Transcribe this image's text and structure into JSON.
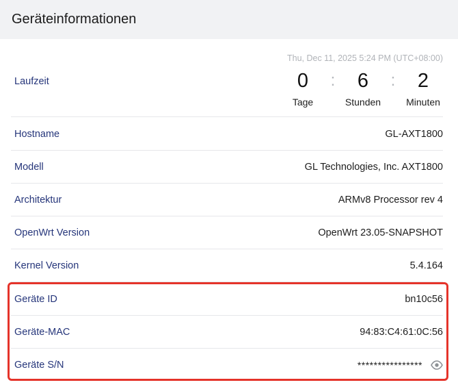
{
  "header": {
    "title": "Geräteinformationen"
  },
  "timestamp": "Thu, Dec 11, 2025 5:24 PM (UTC+08:00)",
  "uptime": {
    "label": "Laufzeit",
    "days": "0",
    "days_label": "Tage",
    "hours": "6",
    "hours_label": "Stunden",
    "minutes": "2",
    "minutes_label": "Minuten",
    "separator": ":"
  },
  "info": {
    "hostname": {
      "label": "Hostname",
      "value": "GL-AXT1800"
    },
    "model": {
      "label": "Modell",
      "value": "GL Technologies, Inc. AXT1800"
    },
    "architecture": {
      "label": "Architektur",
      "value": "ARMv8 Processor rev 4"
    },
    "openwrt": {
      "label": "OpenWrt Version",
      "value": "OpenWrt 23.05-SNAPSHOT"
    },
    "kernel": {
      "label": "Kernel Version",
      "value": "5.4.164"
    },
    "device_id": {
      "label": "Geräte ID",
      "value": "bn10c56"
    },
    "device_mac": {
      "label": "Geräte-MAC",
      "value": "94:83:C4:61:0C:56"
    },
    "device_sn": {
      "label": "Geräte S/N",
      "value": "****************"
    }
  },
  "icons": {
    "sn_toggle": "eye-icon"
  },
  "colors": {
    "highlight": "#e5332a",
    "label": "#25357a"
  }
}
